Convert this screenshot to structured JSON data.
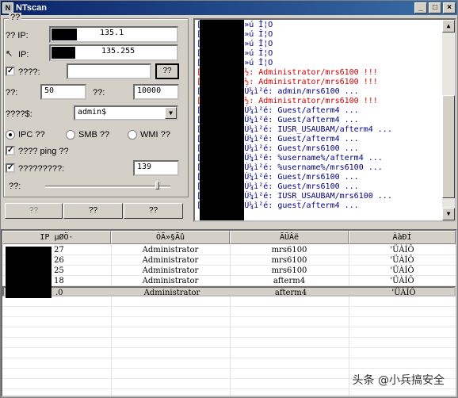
{
  "window": {
    "title": "NTscan",
    "icon": "app-icon",
    "controls": [
      "_",
      "□",
      "×"
    ]
  },
  "options": {
    "legend": "??",
    "start_ip_label": "?? IP:",
    "start_ip_value": "135.1",
    "end_ip_label": "IP:",
    "end_ip_value": "135.255",
    "dict_label": "????:",
    "dict_checked": true,
    "dict_value": "",
    "browse_label": "??",
    "threads_label": "??:",
    "threads_value": "50",
    "timeout_label": "??:",
    "timeout_value": "10000",
    "share_label": "????$:",
    "share_value": "admin$",
    "radio_ipc": "IPC ??",
    "radio_smb": "SMB ??",
    "radio_wmi": "WMI ??",
    "selected_mode": "IPC",
    "ping_label": "???? ping ??",
    "ping_checked": true,
    "port_label": "?????????:",
    "port_checked": true,
    "port_value": "139",
    "speed_label": "??:",
    "speed_level": 0.9
  },
  "buttons": {
    "start": "??",
    "stop": "??",
    "exit": "??"
  },
  "log_lines": [
    {
      "text": "[          254]: Õ÷»ú Î¦O",
      "red": false
    },
    {
      "text": "[          249]: Õ÷»ú Î¦O",
      "red": false
    },
    {
      "text": "[          252]: Õ÷»ú Î¦O",
      "red": false
    },
    {
      "text": "[          251]: Õ÷»ú Î¦O",
      "red": false
    },
    {
      "text": "[          253]: Õ÷»ú Î¦O",
      "red": false
    },
    {
      "text": "[          25]: ÕÒµ½: Administrator/mrs6100 !!!",
      "red": true
    },
    {
      "text": "[          26]: ÕÒµ½: Administrator/mrs6100 !!!",
      "red": true
    },
    {
      "text": "[          28]: ÕýÔÚ¼ì²é: admin/mrs6100 ...",
      "red": false
    },
    {
      "text": "[          27]: ÕÒµ½: Administrator/mrs6100 !!!",
      "red": true
    },
    {
      "text": "[          25]: ÕýÔÚ¼ì²é: Guest/afterm4 ...",
      "red": false
    },
    {
      "text": "[          26]: ÕýÔÚ¼ì²é: Guest/afterm4 ...",
      "red": false
    },
    {
      "text": "[          18]: ÕýÔÚ¼ì²é: IUSR_USAUBAM/afterm4 ...",
      "red": false
    },
    {
      "text": "[          27]: ÕýÔÚ¼ì²é: Guest/afterm4 ...",
      "red": false
    },
    {
      "text": "[          25]: ÕýÔÚ¼ì²é: Guest/mrs6100 ...",
      "red": false
    },
    {
      "text": "[          28]: ÕýÔÚ¼ì²é: %username%/afterm4 ...",
      "red": false
    },
    {
      "text": "[          18]: ÕýÔÚ¼ì²é: %username%/mrs6100 ...",
      "red": false
    },
    {
      "text": "[          26]: ÕýÔÚ¼ì²é: Guest/mrs6100 ...",
      "red": false
    },
    {
      "text": "[          27]: ÕýÔÚ¼ì²é: Guest/mrs6100 ...",
      "red": false
    },
    {
      "text": "[          18]: ÕýÔÚ¼ì²é: IUSR_USAUBAM/mrs6100 ...",
      "red": false
    },
    {
      "text": "[          28]: ÕýÔÚ¼ì²é: guest/afterm4 ...",
      "red": false
    }
  ],
  "table": {
    "headers": [
      "IP µØÖ·",
      "ÓÃ»§Ãû",
      "ÃÜÂë",
      "ÀàÐÍ"
    ],
    "rows": [
      {
        "ip": "27",
        "user": "Administrator",
        "pass": "mrs6100",
        "type": "'ÜÀÍÔ"
      },
      {
        "ip": "26",
        "user": "Administrator",
        "pass": "mrs6100",
        "type": "'ÜÀÍÔ"
      },
      {
        "ip": "25",
        "user": "Administrator",
        "pass": "mrs6100",
        "type": "'ÜÀÍÔ"
      },
      {
        "ip": "18",
        "user": "Administrator",
        "pass": "afterm4",
        "type": "'ÜÀÍÔ"
      },
      {
        "ip": ".0",
        "user": "Administrator",
        "pass": "afterm4",
        "type": "'ÜÀÍÔ"
      }
    ],
    "selected_row": 4
  },
  "watermark": "头条 @小兵搞安全"
}
